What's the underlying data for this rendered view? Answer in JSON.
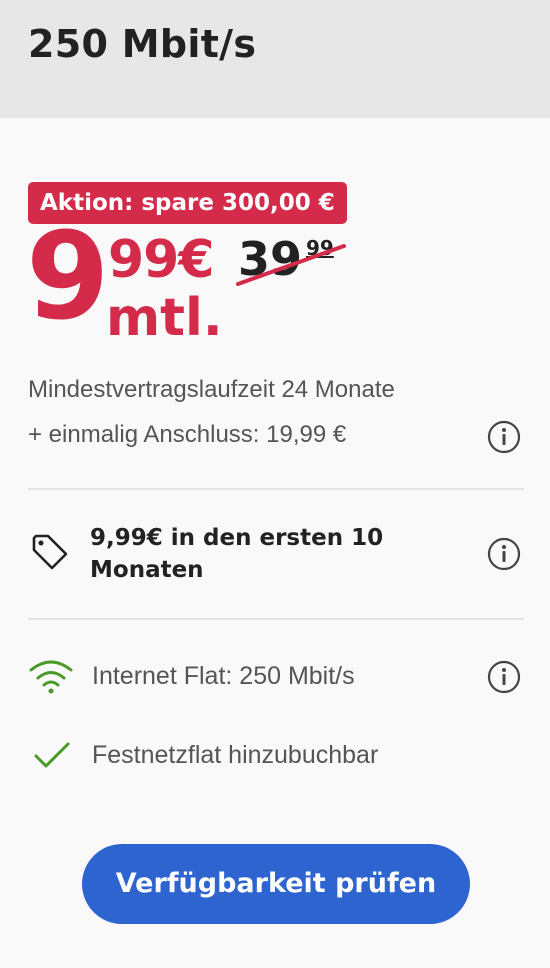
{
  "header": {
    "title": "250 Mbit/s"
  },
  "offer": {
    "badge": "Aktion: spare 300,00 €",
    "price_whole": "9",
    "price_cents": "99€",
    "price_unit": "mtl.",
    "old_price_whole": "39",
    "old_price_cents": "99",
    "min_term": "Mindestvertragslaufzeit 24 Monate",
    "setup_fee": "+ einmalig Anschluss: 19,99 €"
  },
  "promo": {
    "text": "9,99€ in den ersten 10 Monaten"
  },
  "features": [
    {
      "icon": "wifi-icon",
      "label": "Internet Flat: 250 Mbit/s"
    },
    {
      "icon": "check-icon",
      "label": "Festnetzflat hinzubuchbar"
    }
  ],
  "cta": {
    "label": "Verfügbarkeit prüfen"
  },
  "colors": {
    "accent": "#d52b4a",
    "button": "#2e64cf",
    "wifi": "#4a9a2a",
    "check": "#4a9a2a"
  }
}
